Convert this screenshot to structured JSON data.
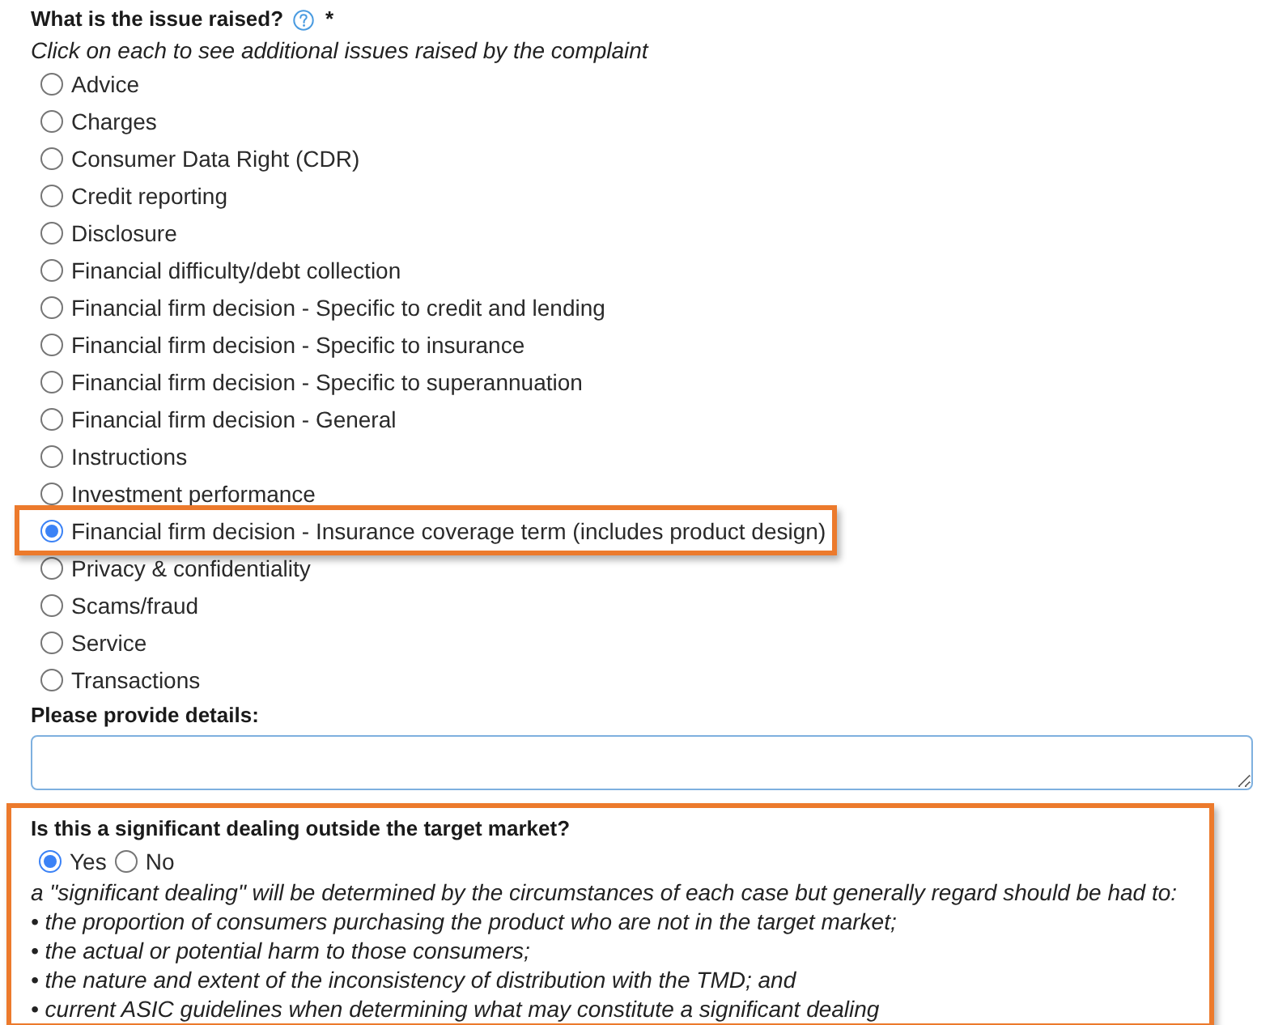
{
  "issue_question": {
    "label": "What is the issue raised?",
    "required_mark": "*",
    "hint": "Click on each to see additional issues raised by the complaint",
    "options": [
      {
        "label": "Advice",
        "selected": false,
        "highlighted": false
      },
      {
        "label": "Charges",
        "selected": false,
        "highlighted": false
      },
      {
        "label": "Consumer Data Right (CDR)",
        "selected": false,
        "highlighted": false
      },
      {
        "label": "Credit reporting",
        "selected": false,
        "highlighted": false
      },
      {
        "label": "Disclosure",
        "selected": false,
        "highlighted": false
      },
      {
        "label": "Financial difficulty/debt collection",
        "selected": false,
        "highlighted": false
      },
      {
        "label": "Financial firm decision - Specific to credit and lending",
        "selected": false,
        "highlighted": false
      },
      {
        "label": "Financial firm decision - Specific to insurance",
        "selected": false,
        "highlighted": false
      },
      {
        "label": "Financial firm decision - Specific to superannuation",
        "selected": false,
        "highlighted": false
      },
      {
        "label": "Financial firm decision - General",
        "selected": false,
        "highlighted": false
      },
      {
        "label": "Instructions",
        "selected": false,
        "highlighted": false
      },
      {
        "label": "Investment performance",
        "selected": false,
        "highlighted": false
      },
      {
        "label": "Financial firm decision - Insurance coverage term (includes product design)",
        "selected": true,
        "highlighted": true
      },
      {
        "label": "Privacy & confidentiality",
        "selected": false,
        "highlighted": false
      },
      {
        "label": "Scams/fraud",
        "selected": false,
        "highlighted": false
      },
      {
        "label": "Service",
        "selected": false,
        "highlighted": false
      },
      {
        "label": "Transactions",
        "selected": false,
        "highlighted": false
      }
    ]
  },
  "details": {
    "label": "Please provide details:"
  },
  "significant_dealing": {
    "highlighted": true,
    "question": "Is this a significant dealing outside the target market?",
    "options": [
      {
        "label": "Yes",
        "selected": true
      },
      {
        "label": "No",
        "selected": false
      }
    ],
    "note_lines": [
      "a \"significant dealing\" will be determined by the circumstances of each case but generally regard should be had to:",
      "• the proportion of consumers purchasing the product who are not in the target market;",
      "• the actual or potential harm to those consumers;",
      "• the nature and extent of the inconsistency of distribution with the TMD; and",
      "• current ASIC guidelines when determining what may constitute a significant dealing"
    ]
  }
}
